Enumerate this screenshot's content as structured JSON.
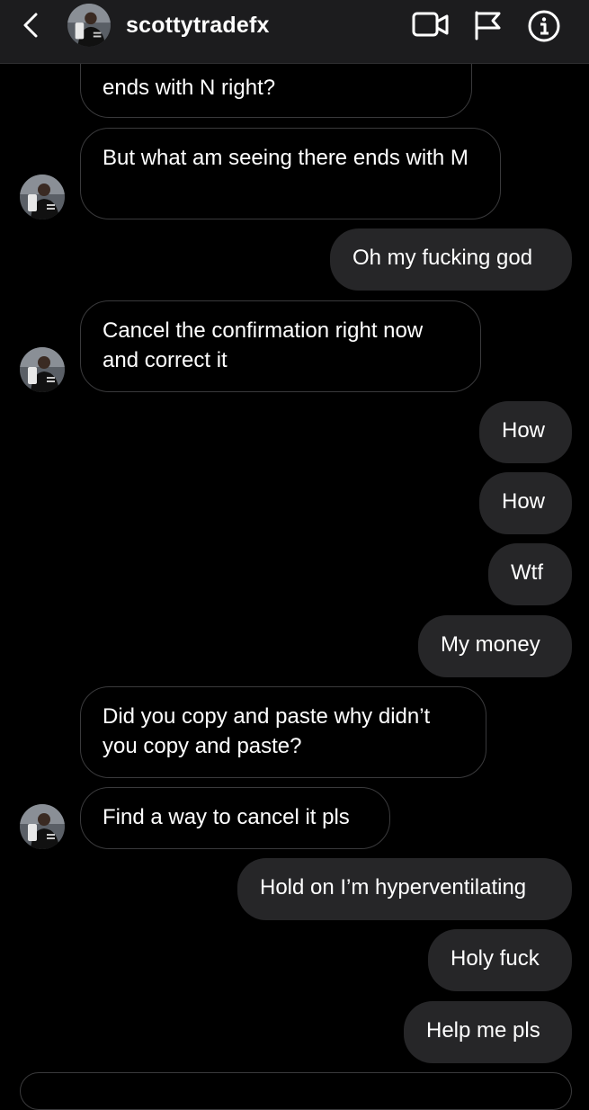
{
  "header": {
    "username": "scottytradefx",
    "icons": [
      "back-chevron-icon",
      "video-call-icon",
      "flag-icon",
      "info-icon"
    ]
  },
  "messages": [
    {
      "from": "them",
      "text": "ends with  N right?"
    },
    {
      "from": "them",
      "text": "But what am seeing there ends with M"
    },
    {
      "from": "me",
      "text": "Oh my fucking god"
    },
    {
      "from": "them",
      "text": "Cancel the confirmation right now and correct it"
    },
    {
      "from": "me",
      "text": "How"
    },
    {
      "from": "me",
      "text": "How"
    },
    {
      "from": "me",
      "text": "Wtf"
    },
    {
      "from": "me",
      "text": "My money"
    },
    {
      "from": "them",
      "text": "Did you copy and paste why didn’t you copy and paste?"
    },
    {
      "from": "them",
      "text": "Find a way to cancel it pls"
    },
    {
      "from": "me",
      "text": "Hold on I’m hyperventilating"
    },
    {
      "from": "me",
      "text": "Holy fuck"
    },
    {
      "from": "me",
      "text": "Help me pls"
    }
  ]
}
